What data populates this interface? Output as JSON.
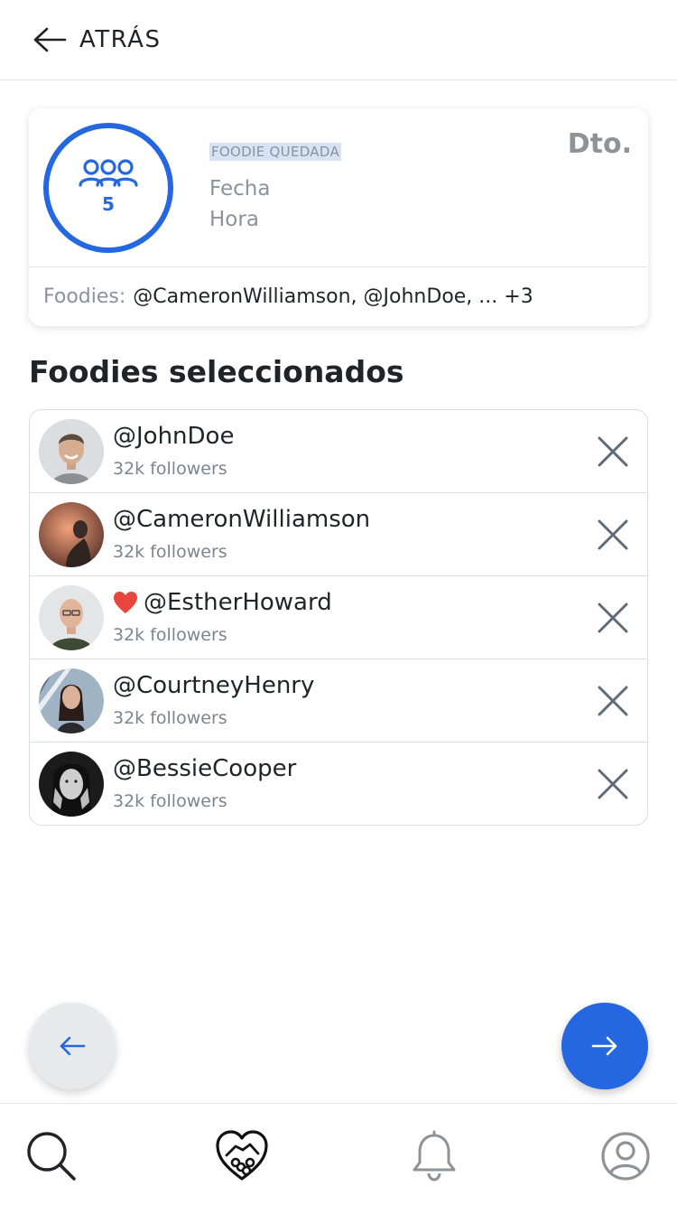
{
  "header": {
    "back_label": "ATRÁS"
  },
  "summary": {
    "group_count": "5",
    "event_type": "FOODIE QUEDADA",
    "date_label": "Fecha",
    "time_label": "Hora",
    "location_label": "Dto.",
    "foodies_label": "Foodies:",
    "foodies_names": "@CameronWilliamson, @JohnDoe, ... +3"
  },
  "section_title": "Foodies seleccionados",
  "foodies": [
    {
      "handle": "@JohnDoe",
      "followers": "32k followers",
      "favorite": false
    },
    {
      "handle": "@CameronWilliamson",
      "followers": "32k followers",
      "favorite": false
    },
    {
      "handle": "@EstherHoward",
      "followers": "32k followers",
      "favorite": true
    },
    {
      "handle": "@CourtneyHenry",
      "followers": "32k followers",
      "favorite": false
    },
    {
      "handle": "@BessieCooper",
      "followers": "32k followers",
      "favorite": false
    }
  ],
  "icons": {
    "back": "arrow-left-icon",
    "group": "group-icon",
    "remove": "close-icon",
    "favorite": "heart-icon",
    "prev": "arrow-left-icon",
    "next": "arrow-right-icon",
    "nav": [
      "search-icon",
      "handshake-heart-icon",
      "bell-icon",
      "profile-icon"
    ]
  },
  "colors": {
    "accent": "#2467e0",
    "heart": "#e8463c",
    "muted_text": "#8a939c",
    "text": "#1f2428"
  }
}
